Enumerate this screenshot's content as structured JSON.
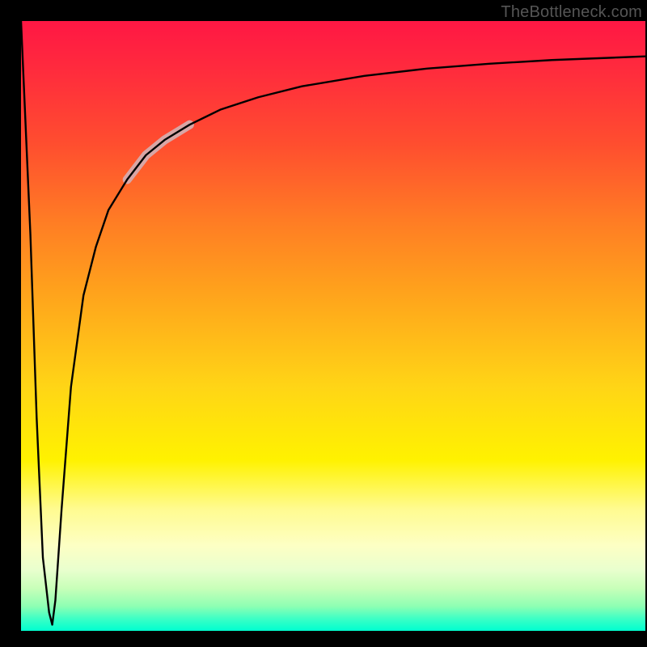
{
  "attribution": "TheBottleneck.com",
  "colors": {
    "frame": "#000000",
    "gradient_top": "#ff1744",
    "gradient_mid": "#fff200",
    "gradient_bottom": "#00ffd0",
    "curve": "#000000",
    "highlight": "#d8a6a6"
  },
  "chart_data": {
    "type": "line",
    "title": "",
    "xlabel": "",
    "ylabel": "",
    "xlim": [
      0,
      100
    ],
    "ylim": [
      0,
      100
    ],
    "grid": false,
    "legend": false,
    "series": [
      {
        "name": "main-curve",
        "x": [
          0,
          1.5,
          2.5,
          3.5,
          4.5,
          5.0,
          5.5,
          6.5,
          8.0,
          10.0,
          12.0,
          14.0,
          17.0,
          20.0,
          23.0,
          27.0,
          32.0,
          38.0,
          45.0,
          55.0,
          65.0,
          75.0,
          85.0,
          95.0,
          100.0
        ],
        "y": [
          100,
          65,
          35,
          12,
          3,
          1,
          5,
          20,
          40,
          55,
          63,
          69,
          74,
          78,
          80.5,
          83,
          85.5,
          87.5,
          89.3,
          91,
          92.2,
          93,
          93.6,
          94,
          94.2
        ]
      }
    ],
    "highlight_segment": {
      "series": "main-curve",
      "x_range": [
        17,
        27
      ],
      "approx_y_range": [
        74,
        83
      ]
    },
    "background": {
      "type": "vertical-gradient",
      "description": "red at top through orange and yellow to green at bottom",
      "stops": [
        {
          "pos": 0.0,
          "color": "#ff1744"
        },
        {
          "pos": 0.33,
          "color": "#ff7d24"
        },
        {
          "pos": 0.72,
          "color": "#fff200"
        },
        {
          "pos": 1.0,
          "color": "#00ffd0"
        }
      ]
    }
  }
}
